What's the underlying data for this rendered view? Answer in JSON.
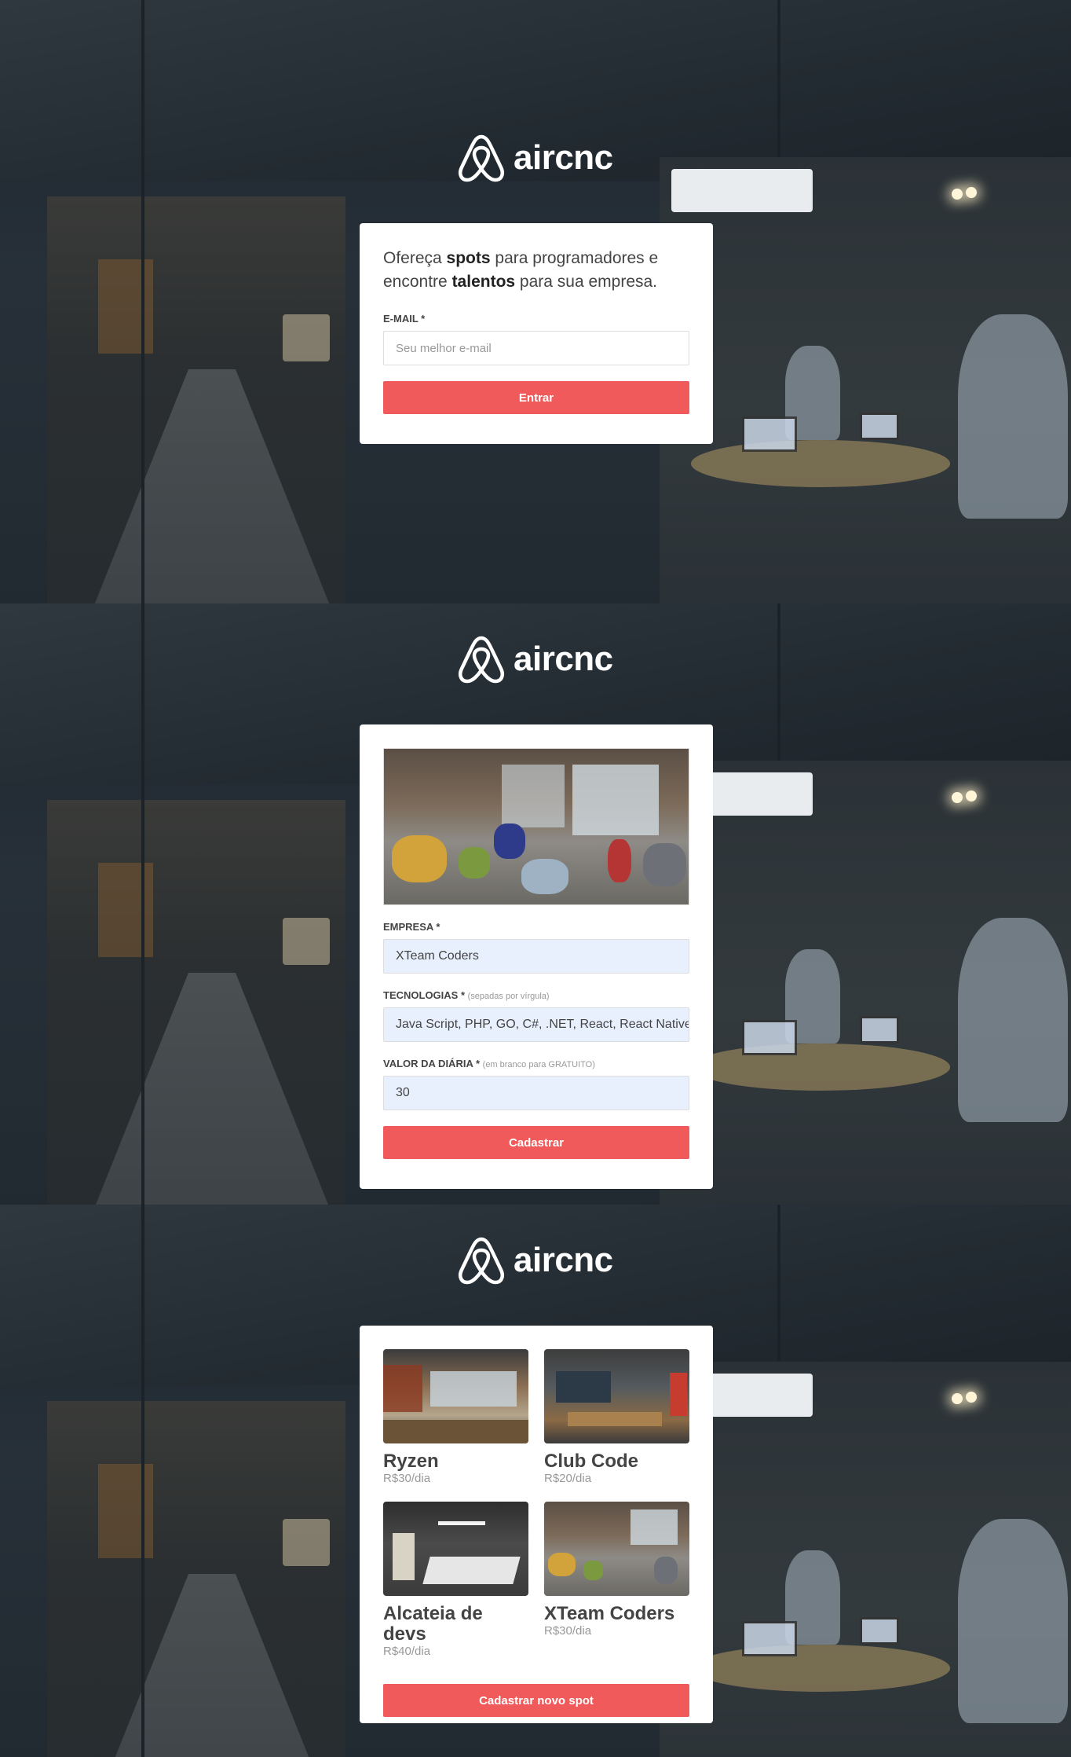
{
  "brand": {
    "name": "aircnc",
    "logo_icon": "airbnb-belo-icon"
  },
  "colors": {
    "accent": "#f05a5b",
    "card": "#ffffff",
    "autofill": "#e8f0fe"
  },
  "login": {
    "tagline_1": "Ofereça ",
    "tagline_bold_1": "spots",
    "tagline_2": " para programadores e encontre ",
    "tagline_bold_2": "talentos",
    "tagline_3": " para sua empresa.",
    "email_label": "E-MAIL *",
    "email_placeholder": "Seu melhor e-mail",
    "submit_label": "Entrar"
  },
  "new_spot": {
    "company_label": "EMPRESA *",
    "company_value": "XTeam Coders",
    "techs_label": "TECNOLOGIAS *",
    "techs_hint": "(sepadas por vírgula)",
    "techs_value": "Java Script, PHP, GO, C#, .NET, React, React Native,",
    "price_label": "VALOR DA DIÁRIA *",
    "price_hint": "(em branco para GRATUITO)",
    "price_value": "30",
    "submit_label": "Cadastrar"
  },
  "dashboard": {
    "spots": [
      {
        "name": "Ryzen",
        "price": "R$30/dia"
      },
      {
        "name": "Club Code",
        "price": "R$20/dia"
      },
      {
        "name": "Alcateia de devs",
        "price": "R$40/dia"
      },
      {
        "name": "XTeam Coders",
        "price": "R$30/dia"
      }
    ],
    "new_spot_label": "Cadastrar novo spot"
  }
}
